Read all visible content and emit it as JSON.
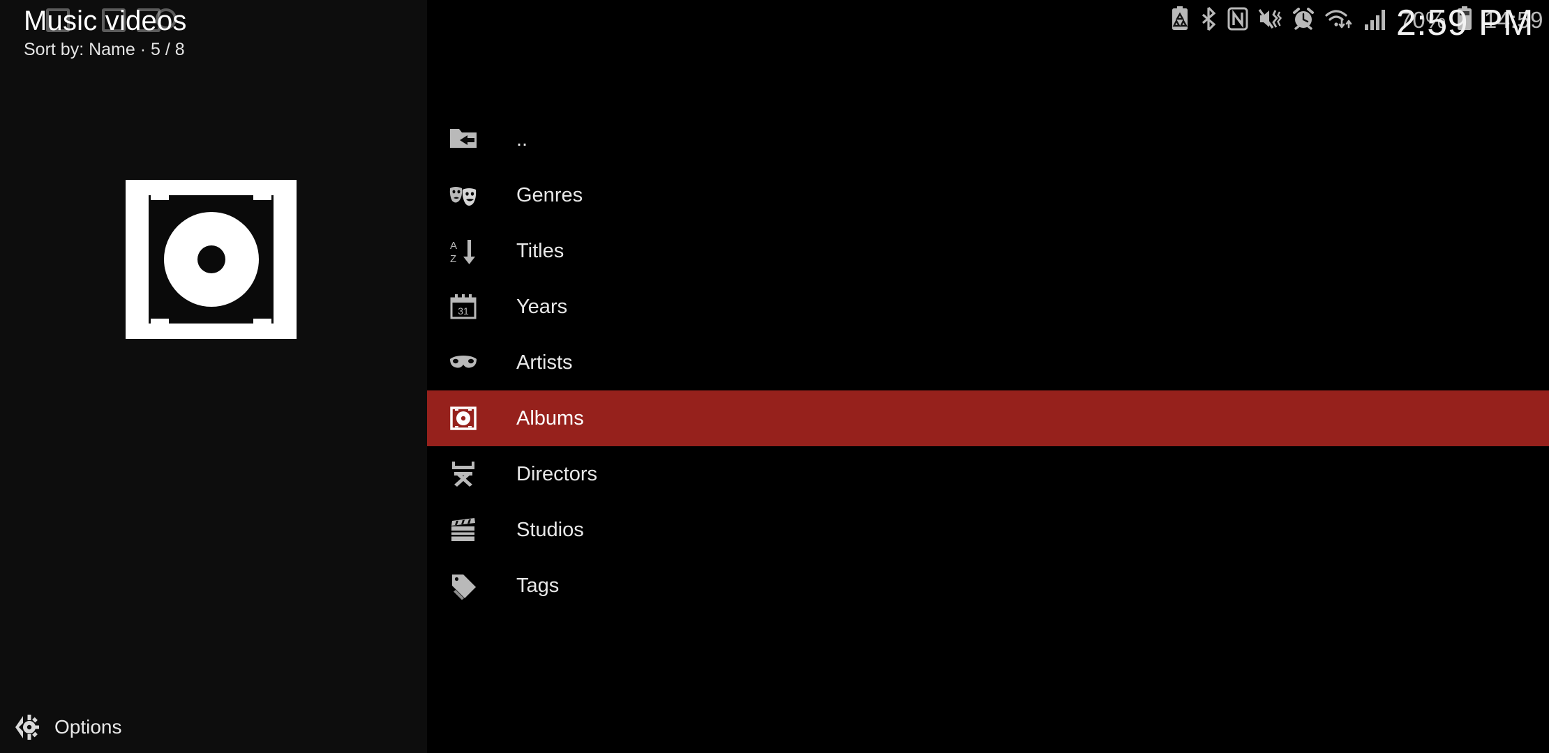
{
  "window": {
    "title": "Music videos",
    "sort_info": "Sort by: Name  ·  5 / 8"
  },
  "poster": {
    "icon": "album-case-icon",
    "alt": "Default album artwork"
  },
  "footer": {
    "options_label": "Options",
    "options_icon": "back-gear-icon"
  },
  "list": {
    "selected_index": 5,
    "highlight_color": "#96211c",
    "items": [
      {
        "label": "..",
        "icon": "folder-back-icon"
      },
      {
        "label": "Genres",
        "icon": "theater-masks-icon"
      },
      {
        "label": "Titles",
        "icon": "sort-az-icon"
      },
      {
        "label": "Years",
        "icon": "calendar-icon"
      },
      {
        "label": "Artists",
        "icon": "mask-icon"
      },
      {
        "label": "Albums",
        "icon": "album-disc-icon"
      },
      {
        "label": "Directors",
        "icon": "director-chair-icon"
      },
      {
        "label": "Studios",
        "icon": "clapperboard-icon"
      },
      {
        "label": "Tags",
        "icon": "tag-icon"
      }
    ]
  },
  "status_bar": {
    "icons": [
      "battery-saver-icon",
      "bluetooth-icon",
      "nfc-icon",
      "volume-mute-vibrate-icon",
      "alarm-clock-icon",
      "wifi-icon",
      "cellular-signal-icon"
    ],
    "battery_percent": "70%",
    "battery_icon": "battery-icon",
    "time": "14:59"
  },
  "kodi_clock": {
    "time": "2:59 PM"
  },
  "colors": {
    "accent": "#96211c",
    "panel_bg": "#0d0d0d",
    "page_bg": "#000000",
    "icon_gray": "#b9b9b9",
    "text": "#e8e8e8"
  }
}
